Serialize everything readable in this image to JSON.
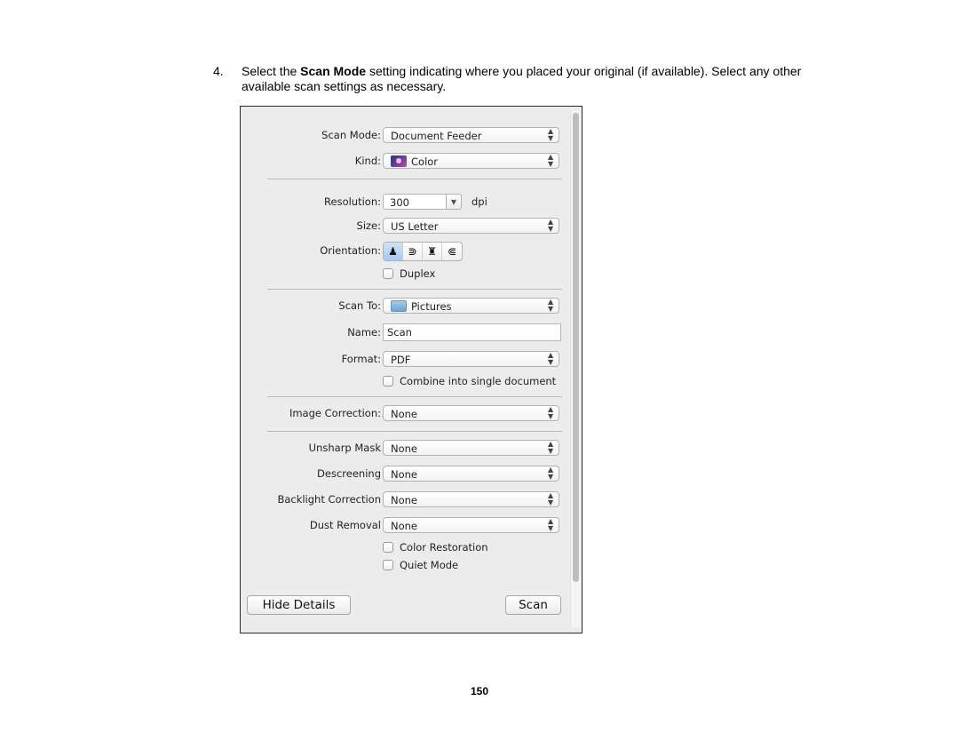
{
  "instruction": {
    "number": "4.",
    "prefix": "Select the ",
    "bold": "Scan Mode",
    "suffix": " setting indicating where you placed your original (if available). Select any other available scan settings as necessary."
  },
  "dialog": {
    "scan_mode": {
      "label": "Scan Mode:",
      "value": "Document Feeder"
    },
    "kind": {
      "label": "Kind:",
      "value": "Color",
      "icon": "color-photo-icon"
    },
    "resolution": {
      "label": "Resolution:",
      "value": "300",
      "unit": "dpi"
    },
    "size": {
      "label": "Size:",
      "value": "US Letter"
    },
    "orientation": {
      "label": "Orientation:",
      "options": [
        {
          "name": "portrait-upright",
          "glyph": "♟",
          "selected": true
        },
        {
          "name": "rotate-right",
          "glyph": "⋑",
          "selected": false
        },
        {
          "name": "upside-down",
          "glyph": "♜",
          "selected": false
        },
        {
          "name": "rotate-left",
          "glyph": "⋐",
          "selected": false
        }
      ]
    },
    "duplex": {
      "label": "Duplex",
      "checked": false
    },
    "scan_to": {
      "label": "Scan To:",
      "value": "Pictures",
      "icon": "folder-icon"
    },
    "name": {
      "label": "Name:",
      "value": "Scan"
    },
    "format": {
      "label": "Format:",
      "value": "PDF"
    },
    "combine": {
      "label": "Combine into single document",
      "checked": false
    },
    "image_correction": {
      "label": "Image Correction:",
      "value": "None"
    },
    "unsharp_mask": {
      "label": "Unsharp Mask",
      "value": "None"
    },
    "descreening": {
      "label": "Descreening",
      "value": "None"
    },
    "backlight_correction": {
      "label": "Backlight Correction",
      "value": "None"
    },
    "dust_removal": {
      "label": "Dust Removal",
      "value": "None"
    },
    "color_restoration": {
      "label": "Color Restoration",
      "checked": false
    },
    "quiet_mode": {
      "label": "Quiet Mode",
      "checked": false
    },
    "hide_details_button": "Hide Details",
    "scan_button": "Scan",
    "popup_arrow_up": "▲",
    "popup_arrow_down": "▼",
    "combo_arrow": "▼"
  },
  "page_number": "150"
}
